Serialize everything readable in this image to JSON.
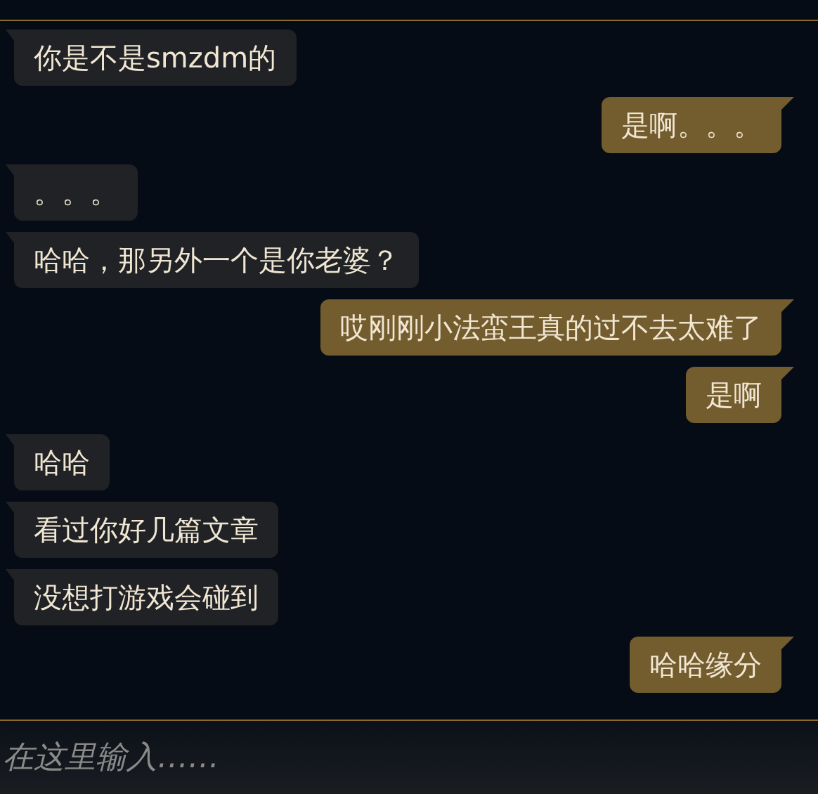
{
  "messages": [
    {
      "kind": "received",
      "text": "你是不是smzdm的"
    },
    {
      "kind": "sent",
      "text": "是啊。。。"
    },
    {
      "kind": "received",
      "text": "。。。"
    },
    {
      "kind": "received",
      "text": "哈哈，那另外一个是你老婆？"
    },
    {
      "kind": "sent",
      "text": "哎刚刚小法蛮王真的过不去太难了"
    },
    {
      "kind": "sent",
      "text": "是啊"
    },
    {
      "kind": "received",
      "text": "哈哈"
    },
    {
      "kind": "received",
      "text": "看过你好几篇文章"
    },
    {
      "kind": "received",
      "text": "没想打游戏会碰到"
    },
    {
      "kind": "sent",
      "text": "哈哈缘分"
    }
  ],
  "input": {
    "placeholder": "在这里输入……"
  }
}
